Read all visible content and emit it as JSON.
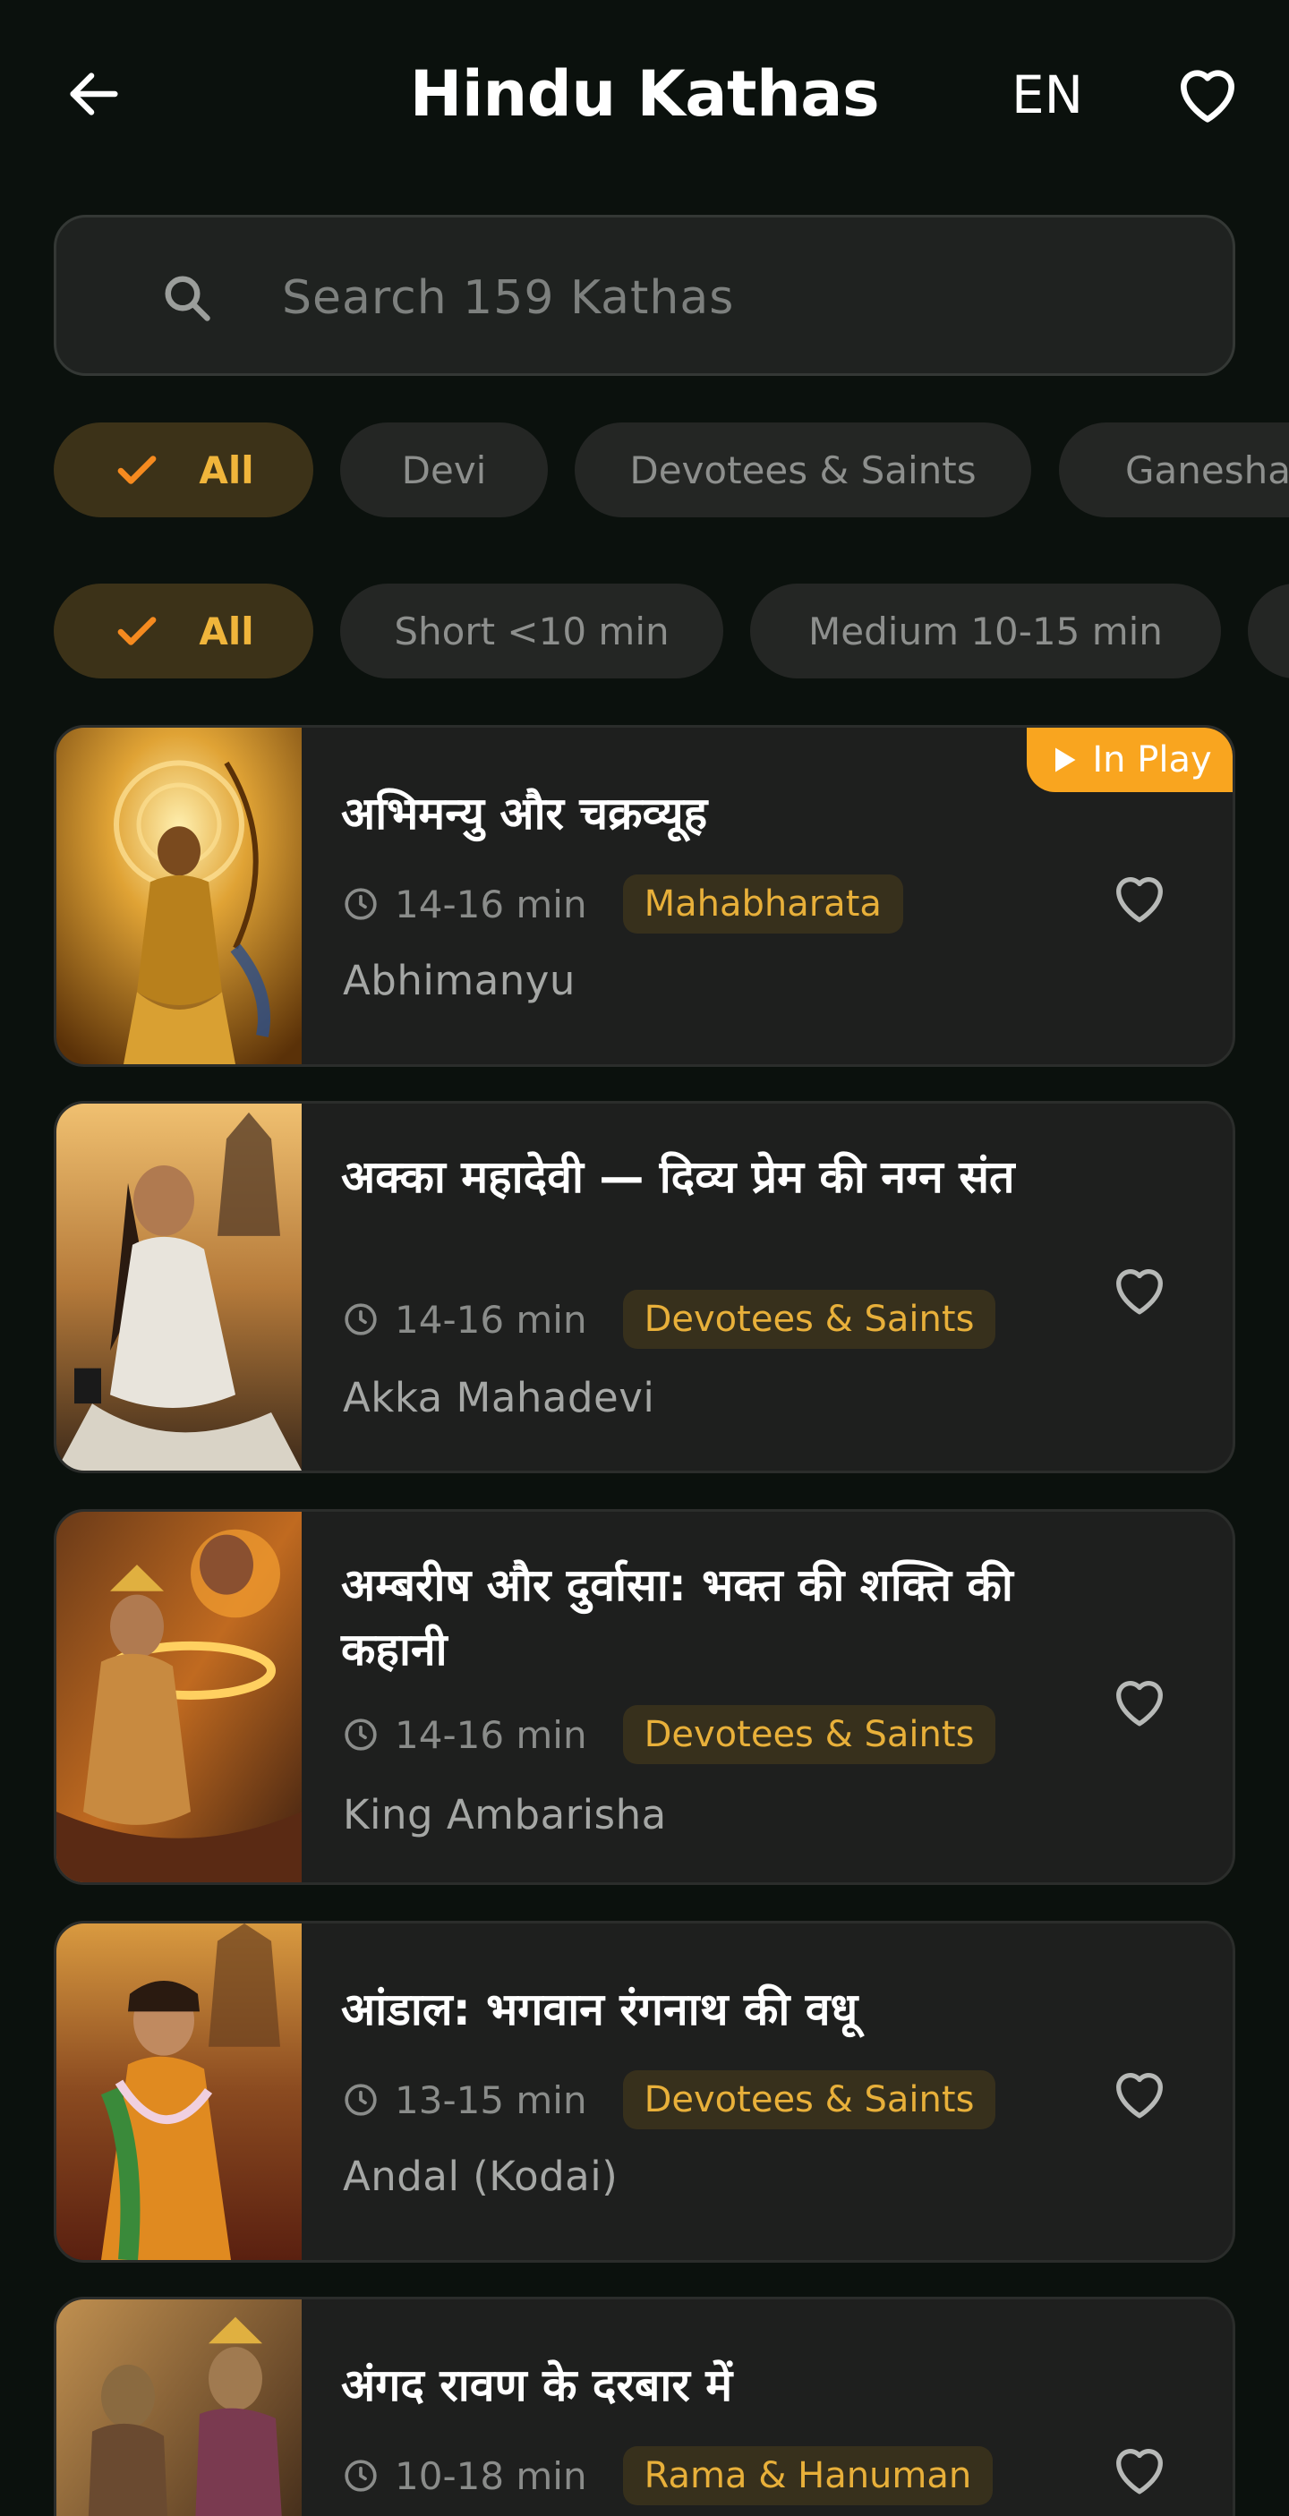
{
  "header": {
    "title": "Hindu Kathas",
    "language": "EN"
  },
  "search": {
    "placeholder": "Search 159 Kathas",
    "value": ""
  },
  "category_filters": [
    {
      "label": "All",
      "selected": true
    },
    {
      "label": "Devi",
      "selected": false
    },
    {
      "label": "Devotees & Saints",
      "selected": false
    },
    {
      "label": "Ganesha",
      "selected": false
    }
  ],
  "duration_filters": [
    {
      "label": "All",
      "selected": true
    },
    {
      "label": "Short <10 min",
      "selected": false
    },
    {
      "label": "Medium 10-15 min",
      "selected": false
    }
  ],
  "in_play_label": "In Play",
  "kathas": [
    {
      "title": "अभिमन्यु और चक्रव्यूह",
      "duration": "14-16 min",
      "category": "Mahabharata",
      "subtitle": "Abhimanyu",
      "in_play": true
    },
    {
      "title": "अक्का महादेवी — दिव्य प्रेम की नग्न संत",
      "duration": "14-16 min",
      "category": "Devotees & Saints",
      "subtitle": "Akka Mahadevi",
      "in_play": false
    },
    {
      "title": "अम्बरीष और दुर्वासा: भक्त की शक्ति की कहानी",
      "duration": "14-16 min",
      "category": "Devotees & Saints",
      "subtitle": "King Ambarisha",
      "in_play": false
    },
    {
      "title": "आंडाल: भगवान रंगनाथ की वधू",
      "duration": "13-15 min",
      "category": "Devotees & Saints",
      "subtitle": "Andal (Kodai)",
      "in_play": false
    },
    {
      "title": "अंगद रावण के दरबार में",
      "duration": "10-18 min",
      "category": "Rama & Hanuman",
      "subtitle": "",
      "in_play": false
    }
  ],
  "colors": {
    "background": "#0b110d",
    "card": "#1e1f1e",
    "accent": "#f9a51f",
    "badge_text": "#e8b03a"
  }
}
